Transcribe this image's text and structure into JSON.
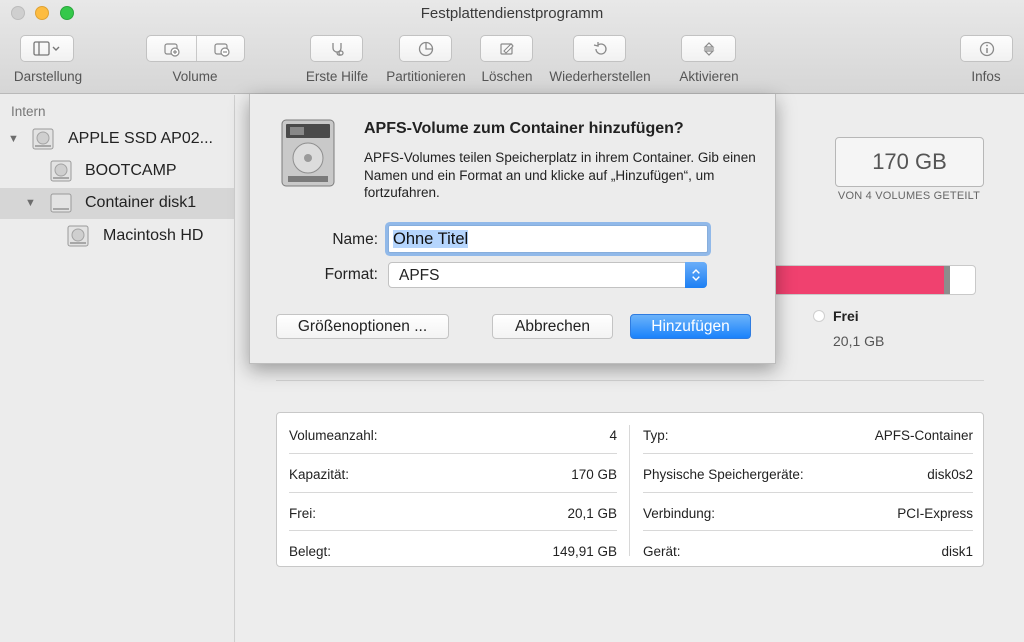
{
  "window": {
    "title": "Festplattendienstprogramm"
  },
  "toolbar": {
    "darstellung": "Darstellung",
    "volume": "Volume",
    "erste_hilfe": "Erste Hilfe",
    "partitionieren": "Partitionieren",
    "loeschen": "Löschen",
    "wiederherstellen": "Wiederherstellen",
    "aktivieren": "Aktivieren",
    "infos": "Infos"
  },
  "sidebar": {
    "heading": "Intern",
    "items": [
      {
        "label": "APPLE SSD AP02..."
      },
      {
        "label": "BOOTCAMP"
      },
      {
        "label": "Container disk1"
      },
      {
        "label": "Macintosh HD"
      }
    ]
  },
  "capacity": {
    "value": "170 GB",
    "caption": "VON 4 VOLUMES GETEILT"
  },
  "usage": {
    "used_fraction": 0.855,
    "legend_free_label": "Frei",
    "legend_free_value": "20,1 GB",
    "used_color": "#f0416f"
  },
  "info": {
    "left": [
      {
        "key": "Volumeanzahl:",
        "value": "4"
      },
      {
        "key": "Kapazität:",
        "value": "170 GB"
      },
      {
        "key": "Frei:",
        "value": "20,1 GB"
      },
      {
        "key": "Belegt:",
        "value": "149,91 GB"
      }
    ],
    "right": [
      {
        "key": "Typ:",
        "value": "APFS-Container"
      },
      {
        "key": "Physische Speichergeräte:",
        "value": "disk0s2"
      },
      {
        "key": "Verbindung:",
        "value": "PCI-Express"
      },
      {
        "key": "Gerät:",
        "value": "disk1"
      }
    ]
  },
  "dialog": {
    "title": "APFS-Volume zum Container hinzufügen?",
    "message": "APFS-Volumes teilen Speicherplatz in ihrem Container. Gib einen Namen und ein Format an und klicke auf „Hinzufügen“, um fortzufahren.",
    "name_label": "Name:",
    "name_value": "Ohne Titel",
    "format_label": "Format:",
    "format_value": "APFS",
    "size_options_button": "Größenoptionen ...",
    "cancel_button": "Abbrechen",
    "add_button": "Hinzufügen"
  }
}
